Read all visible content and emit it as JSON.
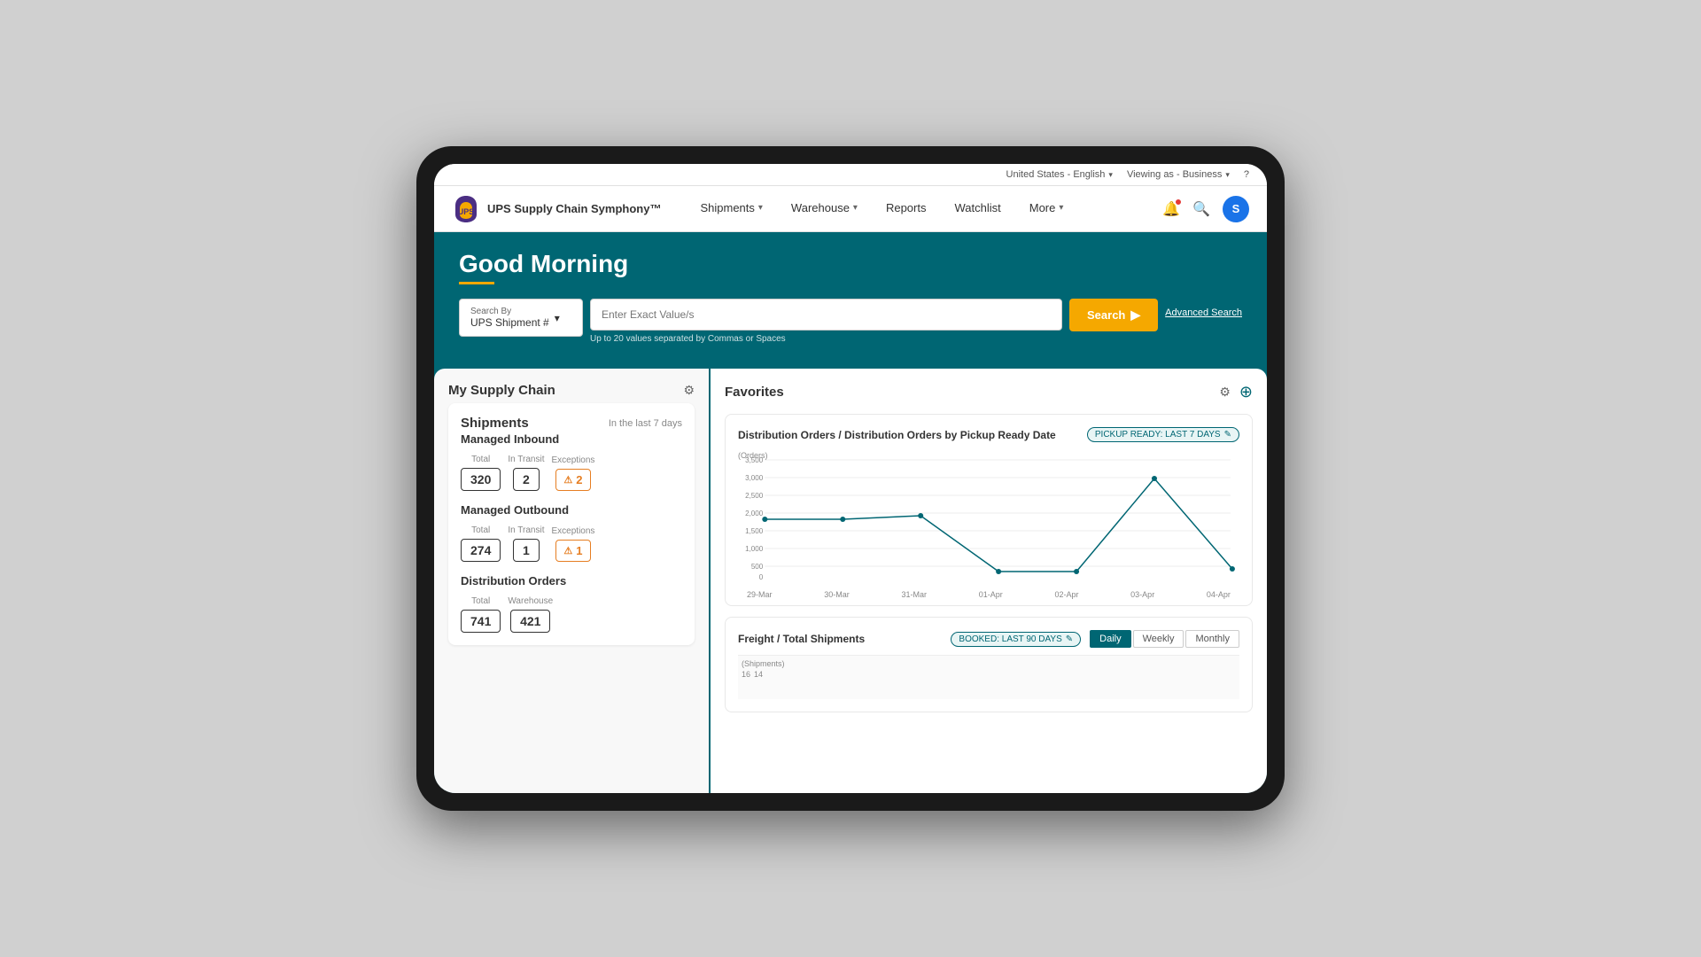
{
  "topBar": {
    "locale": "United States - English",
    "viewing": "Viewing as - Business",
    "help_icon": "?"
  },
  "nav": {
    "logo_text": "UPS",
    "brand": "UPS Supply Chain Symphony™",
    "items": [
      {
        "label": "Shipments",
        "has_dropdown": true
      },
      {
        "label": "Warehouse",
        "has_dropdown": true
      },
      {
        "label": "Reports",
        "has_dropdown": false
      },
      {
        "label": "Watchlist",
        "has_dropdown": false
      },
      {
        "label": "More",
        "has_dropdown": true
      }
    ],
    "avatar_letter": "S"
  },
  "hero": {
    "greeting": "Good Morning",
    "search_by_label": "Search By",
    "search_by_value": "UPS Shipment #",
    "search_placeholder": "Enter Exact Value/s",
    "search_hint": "Up to 20 values separated by Commas or Spaces",
    "search_button": "Search",
    "advanced_search": "Advanced Search"
  },
  "leftPanel": {
    "title": "My Supply Chain",
    "subtitle": "In the last 7 days",
    "cards": [
      {
        "id": "managed_inbound",
        "title": "Managed Inbound",
        "total_label": "Total",
        "total_value": "320",
        "in_transit_label": "In Transit",
        "in_transit_value": "2",
        "exceptions_label": "Exceptions",
        "exceptions_value": "2"
      },
      {
        "id": "managed_outbound",
        "title": "Managed Outbound",
        "total_label": "Total",
        "total_value": "274",
        "in_transit_label": "In Transit",
        "in_transit_value": "1",
        "exceptions_label": "Exceptions",
        "exceptions_value": "1"
      },
      {
        "id": "distribution_orders",
        "title": "Distribution Orders",
        "total_label": "Total",
        "total_value": "741",
        "warehouse_label": "Warehouse",
        "warehouse_value": "421"
      }
    ]
  },
  "rightPanel": {
    "title": "Favorites",
    "charts": [
      {
        "id": "distribution_chart",
        "title": "Distribution Orders / Distribution Orders by Pickup Ready Date",
        "badge": "PICKUP READY: LAST 7 DAYS",
        "y_label": "(Orders)",
        "y_ticks": [
          "3,500",
          "3,000",
          "2,500",
          "2,000",
          "1,500",
          "1,000",
          "500",
          "0"
        ],
        "x_labels": [
          "29-Mar",
          "30-Mar",
          "31-Mar",
          "01-Apr",
          "02-Apr",
          "03-Apr",
          "04-Apr"
        ],
        "data_points": [
          {
            "x": 0,
            "y": 1700
          },
          {
            "x": 1,
            "y": 1750
          },
          {
            "x": 2,
            "y": 1800
          },
          {
            "x": 3,
            "y": 100
          },
          {
            "x": 4,
            "y": 120
          },
          {
            "x": 5,
            "y": 2950
          },
          {
            "x": 6,
            "y": 180
          }
        ],
        "y_min": 0,
        "y_max": 3500
      },
      {
        "id": "freight_chart",
        "title": "Freight / Total Shipments",
        "badge": "BOOKED: LAST 90 DAYS",
        "y_label": "(Shipments)",
        "y_ticks": [
          "16",
          "14"
        ],
        "time_options": [
          "Daily",
          "Weekly",
          "Monthly"
        ],
        "active_time": "Daily"
      }
    ]
  }
}
